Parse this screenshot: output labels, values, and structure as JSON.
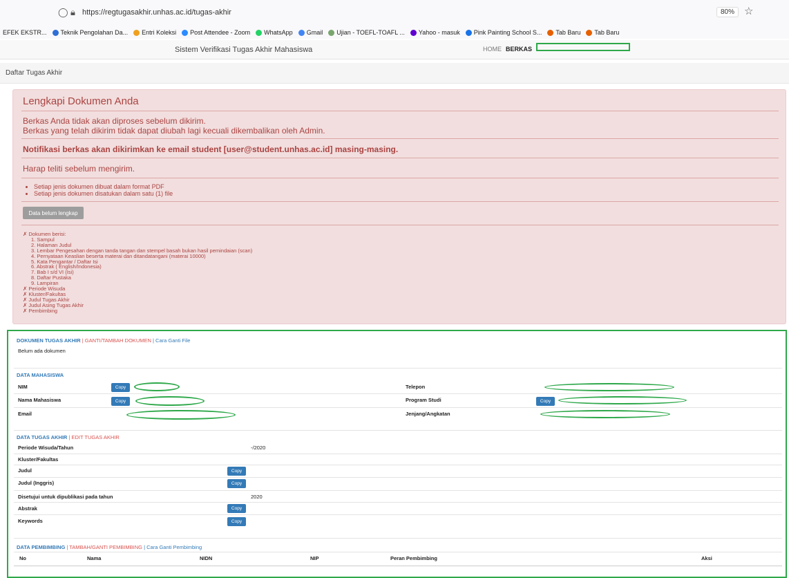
{
  "browser": {
    "url": "https://regtugasakhir.unhas.ac.id/tugas-akhir",
    "zoom": "80%",
    "bookmarks": [
      {
        "label": "EFEK EKSTR...",
        "color": "#cccccc"
      },
      {
        "label": "Teknik Pengolahan Da...",
        "color": "#2f6fd6"
      },
      {
        "label": "Entri Koleksi",
        "color": "#f0a020"
      },
      {
        "label": "Post Attendee - Zoom",
        "color": "#2d8cff"
      },
      {
        "label": "WhatsApp",
        "color": "#25d366"
      },
      {
        "label": "Gmail",
        "color": "#4285f4"
      },
      {
        "label": "Ujian - TOEFL-TOAFL ...",
        "color": "#7aa66e"
      },
      {
        "label": "Yahoo - masuk",
        "color": "#6001d2"
      },
      {
        "label": "Pink Painting School S...",
        "color": "#1a73e8"
      },
      {
        "label": "Tab Baru",
        "color": "#e66000"
      },
      {
        "label": "Tab Baru",
        "color": "#e66000"
      }
    ]
  },
  "nav": {
    "brand": "Sistem Verifikasi Tugas Akhir Mahasiswa",
    "home": "HOME",
    "berkas": "BERKAS"
  },
  "breadcrumb": "Daftar Tugas Akhir",
  "alert": {
    "title": "Lengkapi Dokumen Anda",
    "line1": "Berkas Anda tidak akan diproses sebelum dikirim.",
    "line2": "Berkas yang telah dikirim tidak dapat diubah lagi kecuali dikembalikan oleh Admin.",
    "notif": "Notifikasi berkas akan dikirimkan ke email student [user@student.unhas.ac.id] masing-masing.",
    "warn": "Harap teliti sebelum mengirim.",
    "bullets": [
      "Setiap jenis dokumen dibuat dalam format PDF",
      "Setiap jenis dokumen disatukan dalam satu (1) file"
    ],
    "status_button": "Data belum lengkap",
    "checklist": [
      {
        "text": "✗ Dokumen berisi:",
        "sub": false
      },
      {
        "text": "1. Sampul",
        "sub": true
      },
      {
        "text": "2. Halaman Judul",
        "sub": true
      },
      {
        "text": "3. Lembar Pengesahan dengan tanda tangan dan stempel basah bukan hasil pemindaian (scan)",
        "sub": true
      },
      {
        "text": "4. Pernyataan Keaslian beserta materai dan ditandatangani (materai 10000)",
        "sub": true
      },
      {
        "text": "5. Kata Pengantar / Daftar Isi",
        "sub": true
      },
      {
        "text": "6. Abstrak ( English/Indonesia)",
        "sub": true
      },
      {
        "text": "7. Bab I s/d VI (Isi)",
        "sub": true
      },
      {
        "text": "8. Daftar Pustaka",
        "sub": true
      },
      {
        "text": "9. Lampiran",
        "sub": true
      },
      {
        "text": "✗ Periode Wisuda",
        "sub": false
      },
      {
        "text": "✗ Kluster/Fakultas",
        "sub": false
      },
      {
        "text": "✗ Judul Tugas Akhir",
        "sub": false
      },
      {
        "text": "✗ Judul Asing Tugas Akhir",
        "sub": false
      },
      {
        "text": "✗ Pembimbing",
        "sub": false
      }
    ]
  },
  "dokumen": {
    "title": "DOKUMEN TUGAS AKHIR",
    "link1": "GANTI/TAMBAH DOKUMEN",
    "link2": "Cara Ganti File",
    "empty": "Belum ada dokumen"
  },
  "mahasiswa": {
    "title": "DATA MAHASISWA",
    "nim": "NIM",
    "nama": "Nama Mahasiswa",
    "email": "Email",
    "telepon": "Telepon",
    "prodi": "Program Studi",
    "jenjang": "Jenjang/Angkatan",
    "copy": "Copy"
  },
  "tugas": {
    "title": "DATA TUGAS AKHIR",
    "edit": "EDIT TUGAS AKHIR",
    "periode_label": "Periode Wisuda/Tahun",
    "periode_value": "-/2020",
    "kluster_label": "Kluster/Fakultas",
    "judul_label": "Judul",
    "judul_en_label": "Judul (Inggris)",
    "publikasi_label": "Disetujui untuk dipublikasi pada tahun",
    "publikasi_value": "2020",
    "abstrak_label": "Abstrak",
    "keywords_label": "Keywords",
    "copy": "Copy"
  },
  "pembimbing": {
    "title": "DATA PEMBIMBING",
    "link1": "TAMBAH/GANTI PEMBIMBING",
    "link2": "Cara Ganti Pembimbing",
    "headers": [
      "No",
      "Nama",
      "NIDN",
      "NIP",
      "Peran Pembimbing",
      "Aksi"
    ]
  }
}
